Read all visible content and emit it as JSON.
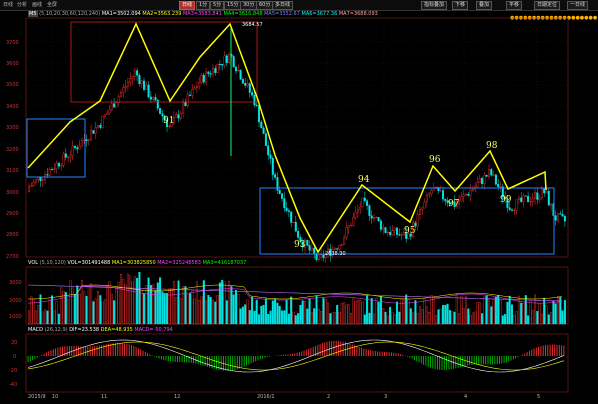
{
  "toolbar": {
    "left_items": [
      "日线",
      "分析",
      "画线",
      "全屏"
    ],
    "period_tabs": [
      "日线",
      "1分",
      "5分",
      "15分",
      "30分",
      "60分",
      "多日线"
    ],
    "active_period": "日线",
    "right_buttons": [
      "",
      "指标叠加",
      "",
      "下移",
      "",
      "叠加",
      "",
      "评分",
      "",
      "平移",
      "",
      "日期定位",
      "一日线"
    ],
    "right_labels": [
      "指标叠加",
      "下移",
      "叠加",
      "平移",
      "日期定位",
      "一日线"
    ]
  },
  "main_legend": {
    "index_id": "M5",
    "params": "(5,10,20,30,60,120,240)",
    "ma1": "MA1=3502.094",
    "ma2": "MA2=3563.239",
    "ma3": "MA3=3583.841",
    "ma4": "MA4=3616.848",
    "ma5": "MA5=3352.67",
    "ma6": "MA6=3677.36",
    "ma7": "MA7=3688.093"
  },
  "price_axis": [
    "3700",
    "3600",
    "3500",
    "3400",
    "3300",
    "3200",
    "3100",
    "3000",
    "2900",
    "2800",
    "2700"
  ],
  "price_markers": {
    "high": "3684.57",
    "low": "2638.30"
  },
  "annotations": [
    "91",
    "93",
    "94",
    "95",
    "96",
    "97",
    "98",
    "99"
  ],
  "volume_legend": {
    "label": "VOL",
    "params": "(5,10,120)",
    "vol": "VOL=301491488",
    "ma1": "MA1=303825850",
    "ma2": "MA2=325248583",
    "ma3": "MA3=416187037"
  },
  "volume_axis": [
    "3000",
    "2000",
    "1000"
  ],
  "macd_legend": {
    "label": "MACD",
    "params": "(26,12,9)",
    "dif": "DIF=23.538",
    "dea": "DEA=48.935",
    "macd": "MACD=-50.794"
  },
  "macd_axis": [
    "20",
    "0",
    "-20",
    "-40"
  ],
  "date_axis": [
    "2015/9",
    "10",
    "11",
    "12",
    "2016/1",
    "2",
    "3",
    "4",
    "5"
  ],
  "colors": {
    "up": "#ff3030",
    "down": "#00e5e5",
    "trend_line": "#ffff00",
    "box_blue": "#1e88ff",
    "box_red": "#cc2020",
    "macd_green": "#00c000"
  }
}
